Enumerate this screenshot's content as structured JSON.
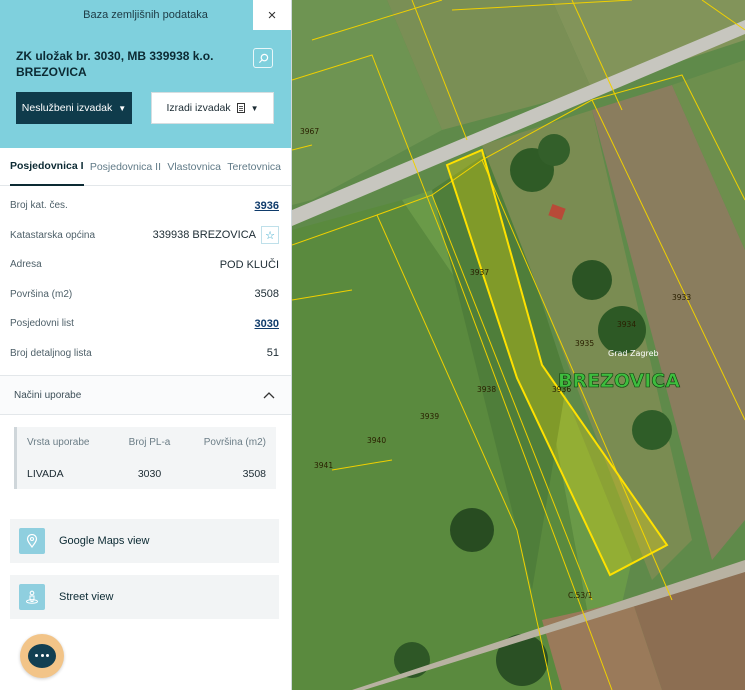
{
  "topbar": {
    "title": "Baza zemljišnih podataka",
    "close_symbol": "×"
  },
  "header": {
    "title": "ZK uložak br. 3030, MB 339938 k.o. BREZOVICA",
    "btn_unofficial": "Neslužbeni izvadak",
    "btn_create": "Izradi izvadak"
  },
  "tabs": [
    "Posjedovnica I",
    "Posjedovnica II",
    "Vlastovnica",
    "Teretovnica"
  ],
  "info": [
    {
      "label": "Broj kat. čes.",
      "value": "3936"
    },
    {
      "label": "Katastarska općina",
      "value": "339938 BREZOVICA"
    },
    {
      "label": "Adresa",
      "value": "POD KLUČI"
    },
    {
      "label": "Površina (m2)",
      "value": "3508"
    },
    {
      "label": "Posjedovni list",
      "value": "3030"
    },
    {
      "label": "Broj detaljnog lista",
      "value": "51"
    }
  ],
  "usage": {
    "section_title": "Načini uporabe",
    "headers": [
      "Vrsta uporabe",
      "Broj PL-a",
      "Površina (m2)"
    ],
    "row": [
      "LIVADA",
      "3030",
      "3508"
    ]
  },
  "links": {
    "maps": "Google Maps view",
    "street": "Street view"
  },
  "map": {
    "parcels": [
      "3967",
      "3937",
      "3933",
      "3934",
      "3935",
      "3938",
      "3936",
      "3939",
      "3940",
      "3941",
      "C.53/1"
    ],
    "place_small": "Grad Zagreb",
    "place_big": "BREZOVICA"
  },
  "icons": {
    "close": "close-icon",
    "search": "search-icon",
    "caret": "caret-down-icon",
    "document": "document-icon",
    "star": "star-icon",
    "chevron": "chevron-up-icon",
    "map_pin": "map-pin-icon",
    "street_person": "street-view-icon",
    "chat": "chat-icon"
  },
  "colors": {
    "header_bg": "#7fd0dd",
    "primary_dark": "#0f3b4b",
    "parcel_border": "#f0d000",
    "selected_parcel": "#ffe100",
    "chat_bubble": "#f2c488"
  }
}
